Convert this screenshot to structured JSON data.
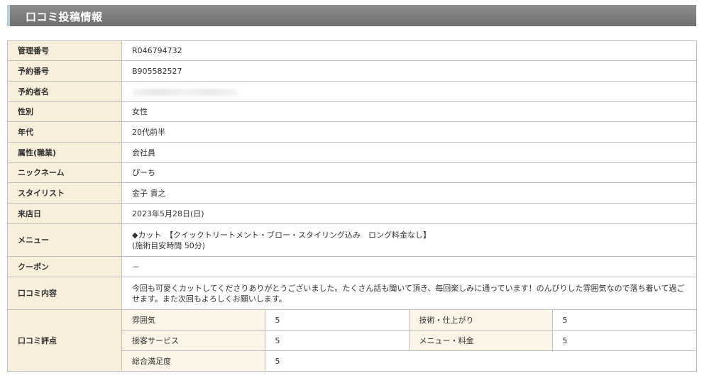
{
  "header": {
    "title": "口コミ投稿情報"
  },
  "rows": {
    "kanri": {
      "label": "管理番号",
      "value": "R046794732"
    },
    "yoyaku": {
      "label": "予約番号",
      "value": "B905582527"
    },
    "name": {
      "label": "予約者名",
      "value": ""
    },
    "gender": {
      "label": "性別",
      "value": "女性"
    },
    "age": {
      "label": "年代",
      "value": "20代前半"
    },
    "job": {
      "label": "属性(職業)",
      "value": "会社員"
    },
    "nickname": {
      "label": "ニックネーム",
      "value": "ぴーち"
    },
    "stylist": {
      "label": "スタイリスト",
      "value": "金子 貴之"
    },
    "visit": {
      "label": "来店日",
      "value": "2023年5月28日(日)"
    },
    "menu": {
      "label": "メニュー",
      "line1": "◆カット　【クイックトリートメント・ブロー・スタイリング込み　ロング料金なし】",
      "line2": "(施術目安時間 50分)"
    },
    "coupon": {
      "label": "クーポン",
      "value": "－"
    },
    "review": {
      "label": "口コミ内容",
      "value": "今回も可愛くカットしてくださりありがとうございました。たくさん話も聞いて頂き、毎回楽しみに通っています！のんびりした雰囲気なので落ち着いて過ごせます。また次回もよろしくお願いします。"
    },
    "rating": {
      "label": "口コミ評点",
      "items": [
        {
          "label": "雰囲気",
          "value": "5"
        },
        {
          "label": "技術・仕上がり",
          "value": "5"
        },
        {
          "label": "接客サービス",
          "value": "5"
        },
        {
          "label": "メニュー・料金",
          "value": "5"
        },
        {
          "label": "総合満足度",
          "value": "5"
        }
      ]
    }
  }
}
